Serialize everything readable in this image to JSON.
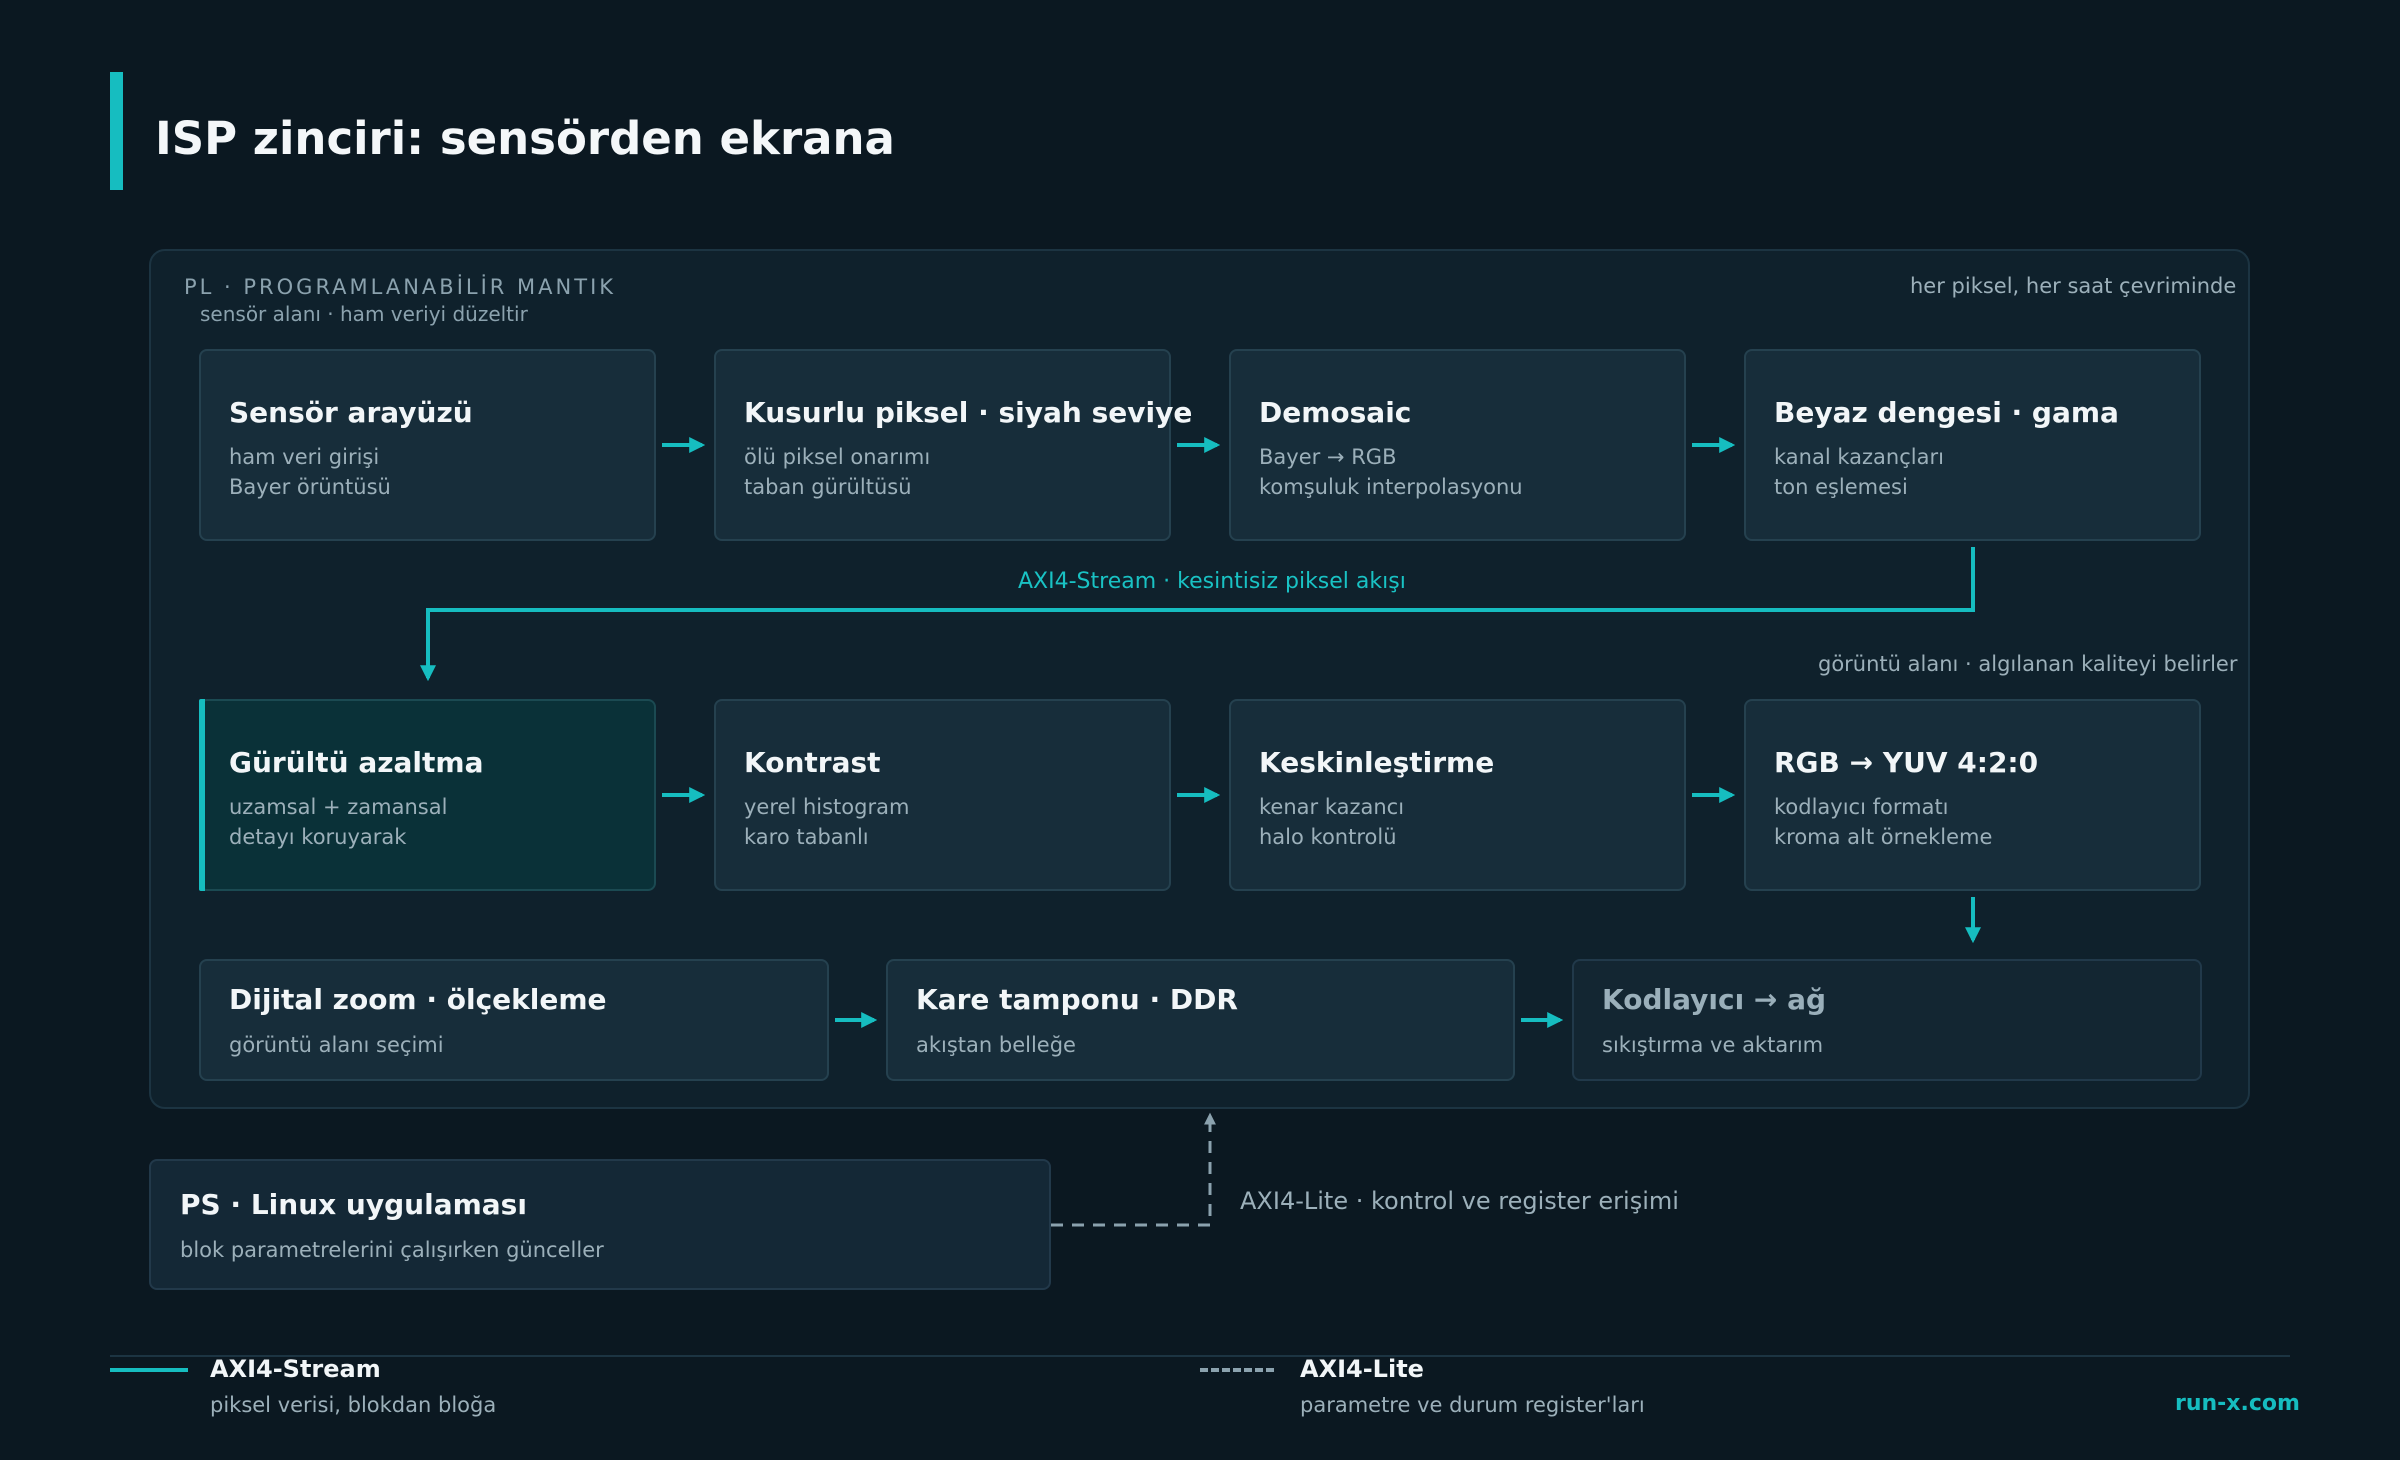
{
  "title": "ISP zinciri: sensörden ekrana",
  "pl": {
    "label": "PL · PROGRAMLANABİLİR MANTIK",
    "subtitle": "sensör alanı · ham veriyi düzeltir",
    "right_note": "her piksel, her saat çevriminde"
  },
  "row1": [
    {
      "title": "Sensör arayüzü",
      "lines": [
        "ham veri girişi",
        "Bayer örüntüsü"
      ]
    },
    {
      "title": "Kusurlu piksel · siyah seviye",
      "lines": [
        "ölü piksel onarımı",
        "taban gürültüsü"
      ]
    },
    {
      "title": "Demosaic",
      "lines": [
        "Bayer → RGB",
        "komşuluk interpolasyonu"
      ]
    },
    {
      "title": "Beyaz dengesi · gama",
      "lines": [
        "kanal kazançları",
        "ton eşlemesi"
      ]
    }
  ],
  "stream_label": "AXI4-Stream · kesintisiz piksel akışı",
  "view_label": "görüntü alanı · algılanan kaliteyi belirler",
  "row2": [
    {
      "title": "Gürültü azaltma",
      "lines": [
        "uzamsal + zamansal",
        "detayı koruyarak"
      ]
    },
    {
      "title": "Kontrast",
      "lines": [
        "yerel histogram",
        "karo tabanlı"
      ]
    },
    {
      "title": "Keskinleştirme",
      "lines": [
        "kenar kazancı",
        "halo kontrolü"
      ]
    },
    {
      "title": "RGB → YUV 4:2:0",
      "lines": [
        "kodlayıcı formatı",
        "kroma alt örnekleme"
      ]
    }
  ],
  "row3": [
    {
      "title": "Dijital zoom · ölçekleme",
      "line": "görüntü alanı seçimi"
    },
    {
      "title": "Kare tamponu · DDR",
      "line": "akıştan belleğe"
    },
    {
      "title": "Kodlayıcı → ağ",
      "line": "sıkıştırma ve aktarım"
    }
  ],
  "ps": {
    "title": "PS · Linux uygulaması",
    "subtitle": "blok parametrelerini çalışırken günceller"
  },
  "lite_label": "AXI4-Lite · kontrol ve register erişimi",
  "legend": {
    "stream_title": "AXI4-Stream",
    "stream_sub": "piksel verisi, blokdan bloğa",
    "lite_title": "AXI4-Lite",
    "lite_sub": "parametre ve durum register'ları"
  },
  "brand": "run-x.com",
  "colors": {
    "accent": "#16bdc0",
    "background": "#0b1821",
    "node_fill": "#172d3a",
    "dashed": "#8ba2ae"
  }
}
